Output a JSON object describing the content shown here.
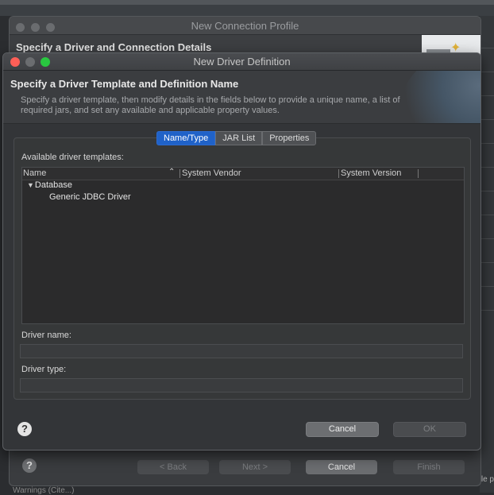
{
  "back_dialog": {
    "title": "New Connection Profile",
    "heading": "Specify a Driver and Connection Details",
    "buttons": {
      "back": "< Back",
      "next": "Next >",
      "cancel": "Cancel",
      "finish": "Finish"
    }
  },
  "background": {
    "bottom_text": "Warnings (Cite...)",
    "right_text": "le p"
  },
  "dialog": {
    "title": "New Driver Definition",
    "heading": "Specify a Driver Template and Definition Name",
    "description": "Specify a driver template, then modify details in the fields below to provide a unique name, a list of required jars, and set any available and applicable property values.",
    "tabs": [
      {
        "label": "Name/Type",
        "active": true
      },
      {
        "label": "JAR List",
        "active": false
      },
      {
        "label": "Properties",
        "active": false
      }
    ],
    "templates_label": "Available driver templates:",
    "columns": [
      "Name",
      "System Vendor",
      "System Version"
    ],
    "tree": [
      {
        "label": "Database",
        "expanded": true,
        "children": [
          {
            "label": "Generic JDBC Driver"
          }
        ]
      }
    ],
    "driver_name_label": "Driver name:",
    "driver_name_value": "",
    "driver_type_label": "Driver type:",
    "driver_type_value": "",
    "buttons": {
      "cancel": "Cancel",
      "ok": "OK"
    },
    "help_symbol": "?"
  },
  "colors": {
    "accent": "#2062c8",
    "close": "#fe5f57",
    "zoom": "#29c840"
  }
}
